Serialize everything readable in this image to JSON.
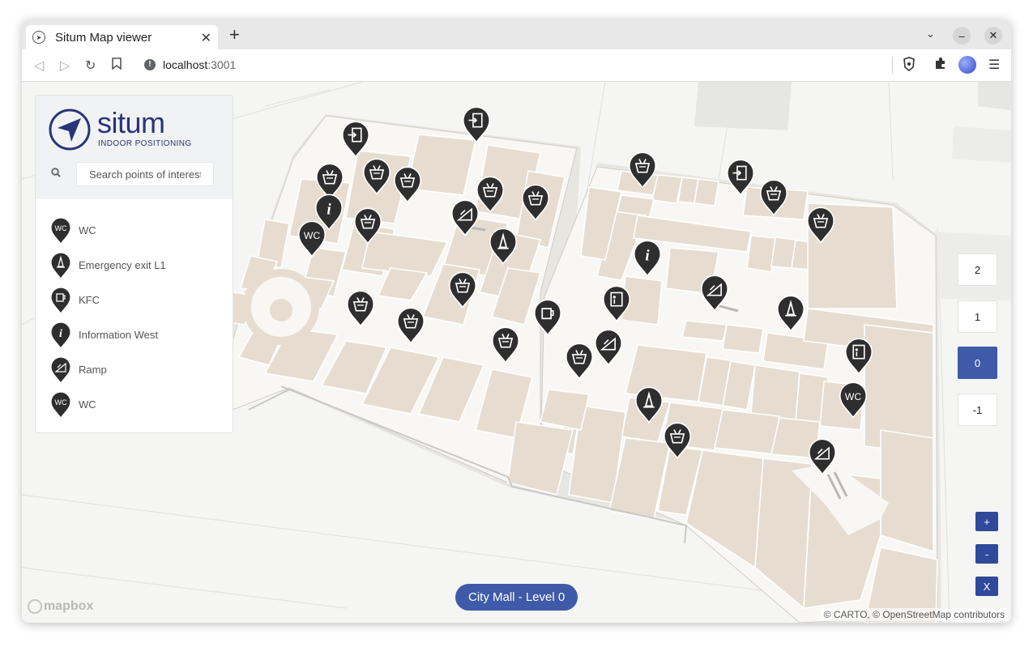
{
  "browser": {
    "tab_title": "Situm Map viewer",
    "url_host": "localhost",
    "url_port": ":3001"
  },
  "panel": {
    "brand": "situm",
    "brand_sub": "INDOOR POSITIONING",
    "search_placeholder": "Search points of interest",
    "pois": [
      {
        "label": "WC",
        "icon": "wc-icon"
      },
      {
        "label": "Emergency exit L1",
        "icon": "emergency-cone-icon"
      },
      {
        "label": "KFC",
        "icon": "coffee-icon"
      },
      {
        "label": "Information West",
        "icon": "info-icon"
      },
      {
        "label": "Ramp",
        "icon": "ramp-icon"
      },
      {
        "label": "WC",
        "icon": "wc-icon"
      }
    ]
  },
  "levels": [
    "2",
    "1",
    "0",
    "-1"
  ],
  "active_level": "0",
  "zoom": {
    "in": "+",
    "out": "-",
    "reset": "X"
  },
  "building_label": "City Mall - Level 0",
  "mapbox_brand": "mapbox",
  "attribution": "© CARTO, © OpenStreetMap contributors",
  "colors": {
    "accent": "#3e5aa9",
    "brand": "#283579",
    "shop": "#e6ddd0",
    "corridor": "#f7f6f3",
    "marker": "#2e2e2e"
  }
}
